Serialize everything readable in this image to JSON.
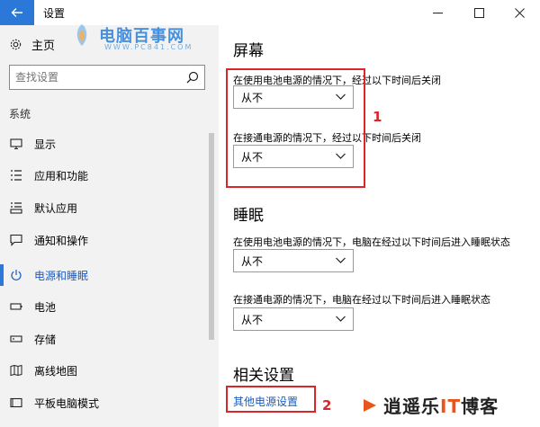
{
  "titlebar": {
    "title": "设置"
  },
  "sidebar": {
    "home_label": "主页",
    "search_placeholder": "查找设置",
    "section_label": "系统",
    "items": [
      {
        "label": "显示",
        "icon": "monitor-icon"
      },
      {
        "label": "应用和功能",
        "icon": "list-icon"
      },
      {
        "label": "默认应用",
        "icon": "default-apps-icon"
      },
      {
        "label": "通知和操作",
        "icon": "notification-icon"
      },
      {
        "label": "电源和睡眠",
        "icon": "power-icon",
        "active": true
      },
      {
        "label": "电池",
        "icon": "battery-icon"
      },
      {
        "label": "存储",
        "icon": "storage-icon"
      },
      {
        "label": "离线地图",
        "icon": "map-icon"
      },
      {
        "label": "平板电脑模式",
        "icon": "tablet-icon"
      }
    ]
  },
  "main": {
    "screen_heading": "屏幕",
    "screen_battery_label": "在使用电池电源的情况下，经过以下时间后关闭",
    "screen_battery_value": "从不",
    "screen_plugged_label": "在接通电源的情况下，经过以下时间后关闭",
    "screen_plugged_value": "从不",
    "sleep_heading": "睡眠",
    "sleep_battery_label": "在使用电池电源的情况下，电脑在经过以下时间后进入睡眠状态",
    "sleep_battery_value": "从不",
    "sleep_plugged_label": "在接通电源的情况下，电脑在经过以下时间后进入睡眠状态",
    "sleep_plugged_value": "从不",
    "related_heading": "相关设置",
    "other_power_link": "其他电源设置"
  },
  "annotations": {
    "num1": "1",
    "num2": "2"
  },
  "watermarks": {
    "top": "电脑百事网",
    "top_sub": "WWW.PC841.COM",
    "bottom_a": "逍遥乐",
    "bottom_it": "IT",
    "bottom_b": "博客"
  },
  "colors": {
    "accent": "#2b78d8",
    "annotation": "#d9262a",
    "link": "#1a5bbf"
  }
}
